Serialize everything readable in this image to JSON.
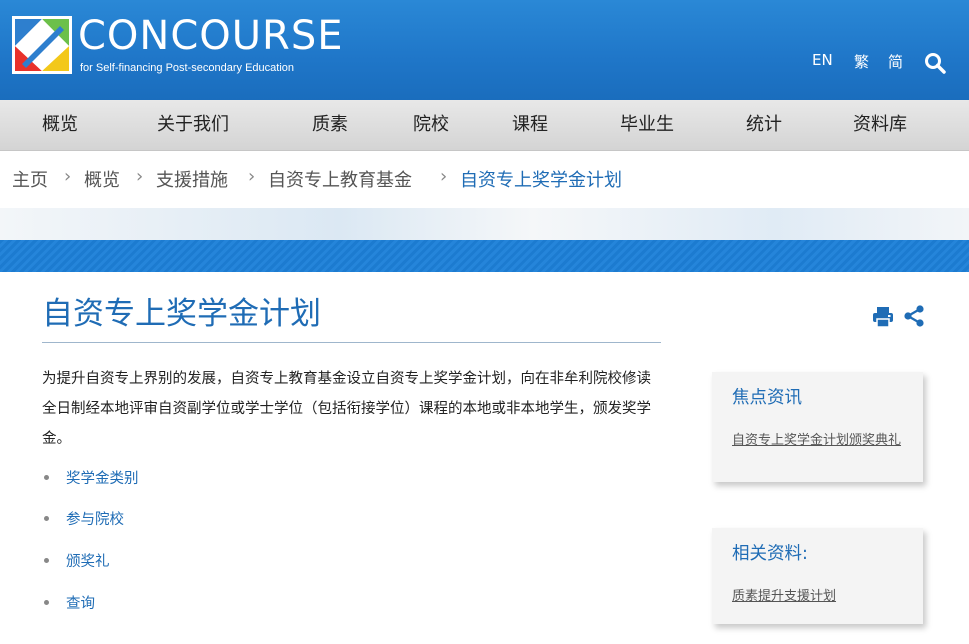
{
  "header": {
    "brand": "CONCOURSE",
    "brand_sub": "for Self-financing Post-secondary Education",
    "lang_en": "EN",
    "lang_tc": "繁",
    "lang_sc": "简",
    "search_icon": "search-icon",
    "bg_color": "#1f76c8"
  },
  "nav": {
    "items": [
      "概览",
      "关于我们",
      "质素",
      "院校",
      "课程",
      "毕业生",
      "统计",
      "资料库"
    ]
  },
  "breadcrumb": {
    "items": [
      "主页",
      "概览",
      "支援措施",
      "自资专上教育基金",
      "自资专上奖学金计划"
    ],
    "separator": "›"
  },
  "main": {
    "title": "自资专上奖学金计划",
    "intro": "为提升自资专上界别的发展，自资专上教育基金设立自资专上奖学金计划，向在非牟利院校修读全日制经本地评审自资副学位或学士学位（包括衔接学位）课程的本地或非本地学生，颁发奖学金。",
    "links": [
      "奖学金类别",
      "参与院校",
      "颁奖礼",
      "查询"
    ],
    "tools": [
      "print-icon",
      "share-icon"
    ],
    "accent_color": "#1f6cb5"
  },
  "sidebar": {
    "focus_title": "焦点资讯",
    "focus_link": "自资专上奖学金计划颁奖典礼",
    "related_title": "相关资料:",
    "related_link": "质素提升支援计划"
  }
}
